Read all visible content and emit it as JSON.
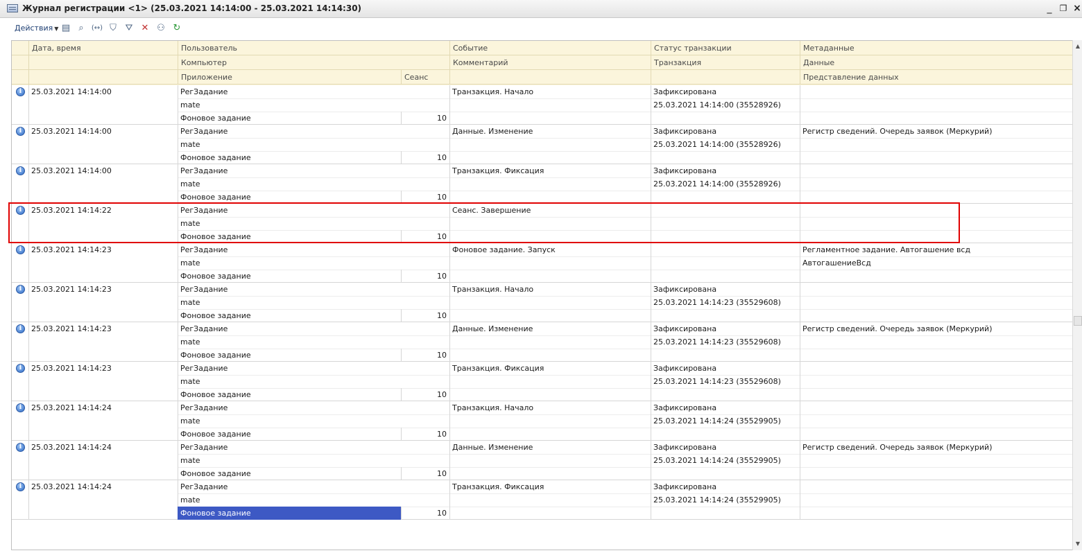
{
  "window": {
    "title": "Журнал регистрации <1> (25.03.2021 14:14:00 - 25.03.2021 14:14:30)",
    "min": "_",
    "max": "❐",
    "close": "×"
  },
  "toolbar": {
    "actions_label": "Действия",
    "icons": [
      "properties-icon",
      "find-icon",
      "interval-icon",
      "filter-icon",
      "filter-settings-icon",
      "clear-filter-icon",
      "users-icon",
      "refresh-icon"
    ]
  },
  "columns": {
    "date": "Дата, время",
    "user": "Пользователь",
    "computer": "Компьютер",
    "application": "Приложение",
    "session": "Сеанс",
    "event": "Событие",
    "comment": "Комментарий",
    "status": "Статус транзакции",
    "transaction": "Транзакция",
    "metadata": "Метаданные",
    "data": "Данные",
    "data_presentation": "Представление данных"
  },
  "rows": [
    {
      "date": "25.03.2021 14:14:00",
      "user": "РегЗадание",
      "computer": "mate",
      "app": "Фоновое задание",
      "session": "10",
      "event": "Транзакция. Начало",
      "comment": "",
      "status": "Зафиксирована",
      "transaction": "25.03.2021 14:14:00 (35528926)",
      "metadata": "",
      "data": "",
      "presentation": ""
    },
    {
      "date": "25.03.2021 14:14:00",
      "user": "РегЗадание",
      "computer": "mate",
      "app": "Фоновое задание",
      "session": "10",
      "event": "Данные. Изменение",
      "comment": "",
      "status": "Зафиксирована",
      "transaction": "25.03.2021 14:14:00 (35528926)",
      "metadata": "Регистр сведений. Очередь заявок (Меркурий)",
      "data": "",
      "presentation": ""
    },
    {
      "date": "25.03.2021 14:14:00",
      "user": "РегЗадание",
      "computer": "mate",
      "app": "Фоновое задание",
      "session": "10",
      "event": "Транзакция. Фиксация",
      "comment": "",
      "status": "Зафиксирована",
      "transaction": "25.03.2021 14:14:00 (35528926)",
      "metadata": "",
      "data": "",
      "presentation": ""
    },
    {
      "date": "25.03.2021 14:14:22",
      "user": "РегЗадание",
      "computer": "mate",
      "app": "Фоновое задание",
      "session": "10",
      "event": "Сеанс. Завершение",
      "comment": "",
      "status": "",
      "transaction": "",
      "metadata": "",
      "data": "",
      "presentation": ""
    },
    {
      "date": "25.03.2021 14:14:23",
      "user": "РегЗадание",
      "computer": "mate",
      "app": "Фоновое задание",
      "session": "10",
      "event": "Фоновое задание. Запуск",
      "comment": "",
      "status": "",
      "transaction": "",
      "metadata": "Регламентное задание. Автогашение всд",
      "data": "АвтогашениеВсд",
      "presentation": ""
    },
    {
      "date": "25.03.2021 14:14:23",
      "user": "РегЗадание",
      "computer": "mate",
      "app": "Фоновое задание",
      "session": "10",
      "event": "Транзакция. Начало",
      "comment": "",
      "status": "Зафиксирована",
      "transaction": "25.03.2021 14:14:23 (35529608)",
      "metadata": "",
      "data": "",
      "presentation": ""
    },
    {
      "date": "25.03.2021 14:14:23",
      "user": "РегЗадание",
      "computer": "mate",
      "app": "Фоновое задание",
      "session": "10",
      "event": "Данные. Изменение",
      "comment": "",
      "status": "Зафиксирована",
      "transaction": "25.03.2021 14:14:23 (35529608)",
      "metadata": "Регистр сведений. Очередь заявок (Меркурий)",
      "data": "",
      "presentation": ""
    },
    {
      "date": "25.03.2021 14:14:23",
      "user": "РегЗадание",
      "computer": "mate",
      "app": "Фоновое задание",
      "session": "10",
      "event": "Транзакция. Фиксация",
      "comment": "",
      "status": "Зафиксирована",
      "transaction": "25.03.2021 14:14:23 (35529608)",
      "metadata": "",
      "data": "",
      "presentation": ""
    },
    {
      "date": "25.03.2021 14:14:24",
      "user": "РегЗадание",
      "computer": "mate",
      "app": "Фоновое задание",
      "session": "10",
      "event": "Транзакция. Начало",
      "comment": "",
      "status": "Зафиксирована",
      "transaction": "25.03.2021 14:14:24 (35529905)",
      "metadata": "",
      "data": "",
      "presentation": ""
    },
    {
      "date": "25.03.2021 14:14:24",
      "user": "РегЗадание",
      "computer": "mate",
      "app": "Фоновое задание",
      "session": "10",
      "event": "Данные. Изменение",
      "comment": "",
      "status": "Зафиксирована",
      "transaction": "25.03.2021 14:14:24 (35529905)",
      "metadata": "Регистр сведений. Очередь заявок (Меркурий)",
      "data": "",
      "presentation": ""
    },
    {
      "date": "25.03.2021 14:14:24",
      "user": "РегЗадание",
      "computer": "mate",
      "app": "Фоновое задание",
      "session": "10",
      "event": "Транзакция. Фиксация",
      "comment": "",
      "status": "Зафиксирована",
      "transaction": "25.03.2021 14:14:24 (35529905)",
      "metadata": "",
      "data": "",
      "presentation": ""
    }
  ],
  "selection": {
    "row": 10,
    "field": "app"
  },
  "highlight": {
    "row": 3
  },
  "colors": {
    "header_bg": "#fbf5dc",
    "selection": "#3d59c4",
    "highlight_border": "#e00000",
    "info_icon": "#2d6ac4"
  }
}
